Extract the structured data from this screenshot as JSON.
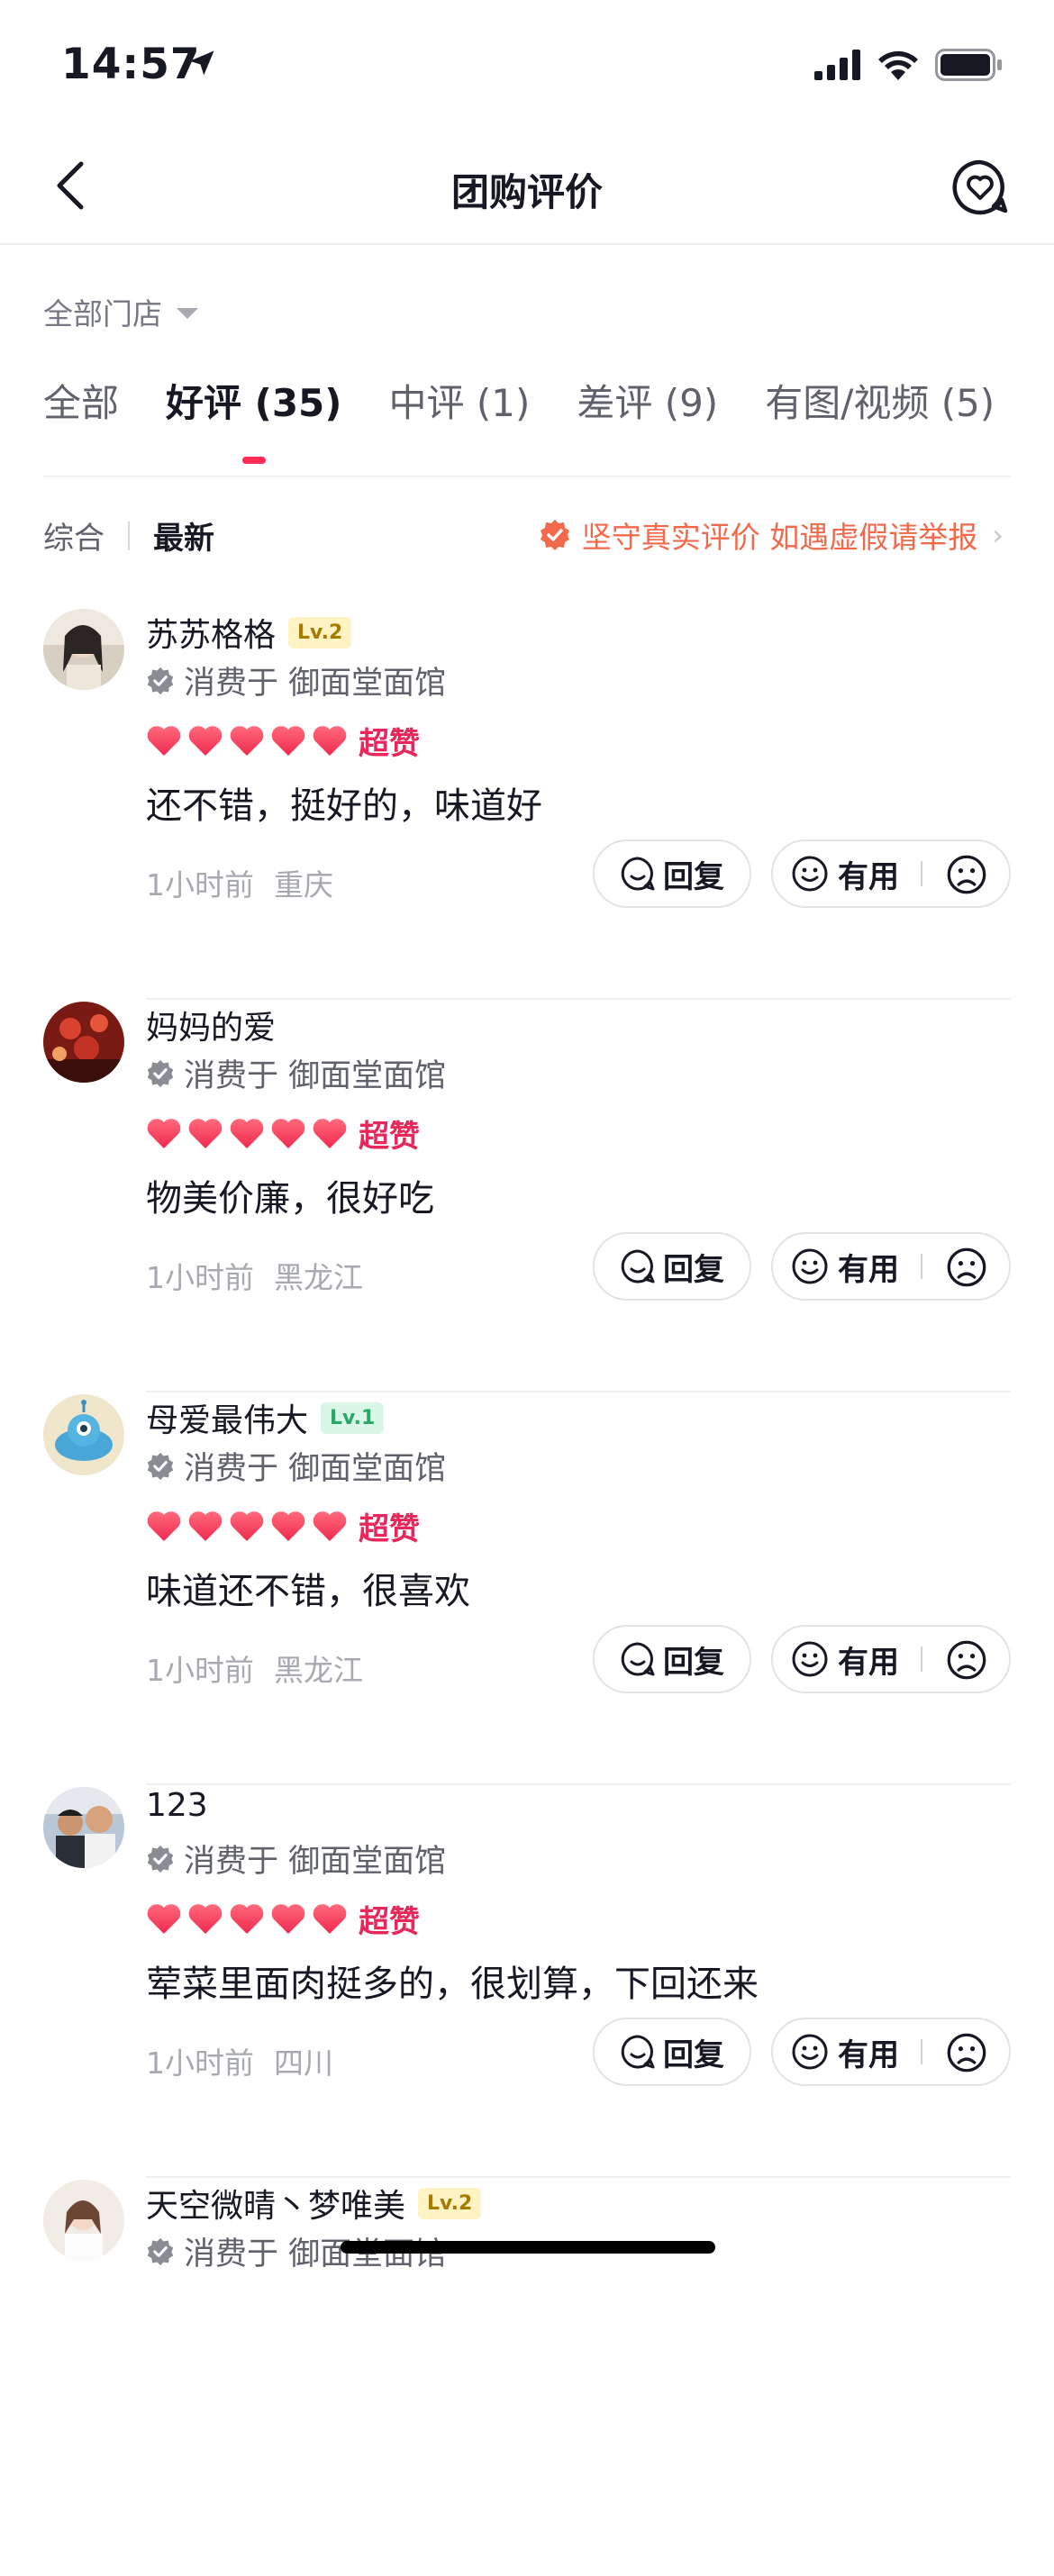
{
  "status_bar": {
    "time": "14:57"
  },
  "nav": {
    "title": "团购评价"
  },
  "store_filter": {
    "label": "全部门店"
  },
  "tabs": [
    {
      "label": "全部"
    },
    {
      "label": "好评 (35)"
    },
    {
      "label": "中评 (1)"
    },
    {
      "label": "差评 (9)"
    },
    {
      "label": "有图/视频 (5)"
    }
  ],
  "active_tab": "好评 (35)",
  "sort": {
    "comprehensive": "综合",
    "latest": "最新"
  },
  "authentic_notice": "坚守真实评价 如遇虚假请举报",
  "buttons": {
    "reply": "回复",
    "useful": "有用"
  },
  "colors": {
    "accent": "#fe2c55",
    "rating": "#e6285a",
    "notice": "#f2694c"
  },
  "reviews": [
    {
      "name": "苏苏格格",
      "level": "Lv.2",
      "consumed": "消费于 御面堂面馆",
      "hearts": 5,
      "rating_label": "超赞",
      "text": "还不错，挺好的，味道好",
      "time": "1小时前",
      "location": "重庆"
    },
    {
      "name": "妈妈的爱",
      "level": "",
      "consumed": "消费于 御面堂面馆",
      "hearts": 5,
      "rating_label": "超赞",
      "text": "物美价廉，很好吃",
      "time": "1小时前",
      "location": "黑龙江"
    },
    {
      "name": "母爱最伟大",
      "level": "Lv.1",
      "consumed": "消费于 御面堂面馆",
      "hearts": 5,
      "rating_label": "超赞",
      "text": "味道还不错，很喜欢",
      "time": "1小时前",
      "location": "黑龙江"
    },
    {
      "name": "123",
      "level": "",
      "consumed": "消费于 御面堂面馆",
      "hearts": 5,
      "rating_label": "超赞",
      "text": "荤菜里面肉挺多的，很划算，下回还来",
      "time": "1小时前",
      "location": "四川"
    },
    {
      "name": "天空微晴丶梦唯美",
      "level": "Lv.2",
      "consumed": "消费于 御面堂面馆"
    }
  ]
}
